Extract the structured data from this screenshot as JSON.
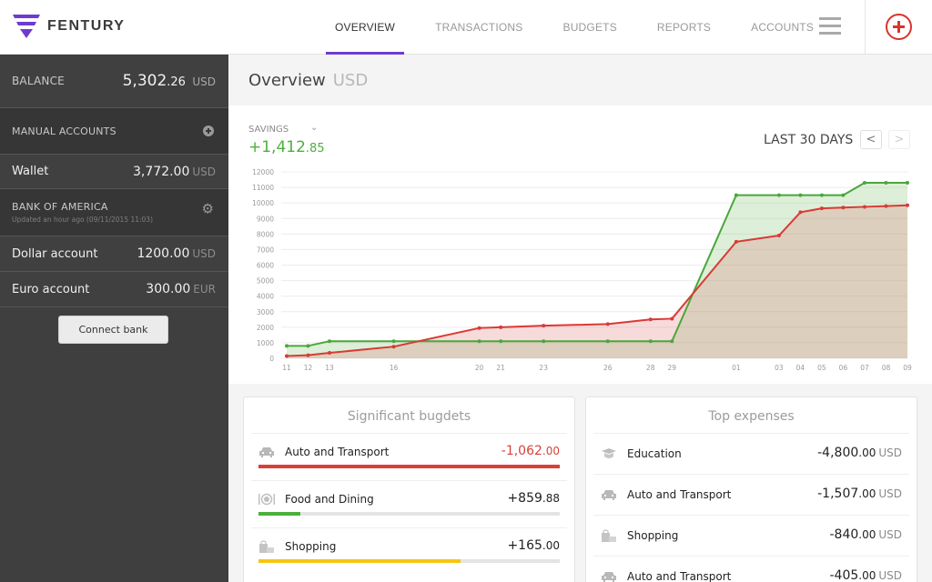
{
  "app": {
    "brand": "FENTURY",
    "brand_color": "#6f3bcf",
    "accent_red": "#d9342b"
  },
  "nav": {
    "items": [
      {
        "label": "OVERVIEW",
        "active": true
      },
      {
        "label": "TRANSACTIONS",
        "active": false
      },
      {
        "label": "BUDGETS",
        "active": false
      },
      {
        "label": "REPORTS",
        "active": false
      },
      {
        "label": "ACCOUNTS",
        "active": false
      }
    ],
    "menu_icon": "hamburger-icon",
    "add_icon": "plus-circle-icon"
  },
  "sidebar": {
    "balance": {
      "label": "BALANCE",
      "int": "5,302",
      "dec": ".26",
      "currency": "USD"
    },
    "manual_accounts": {
      "label": "MANUAL ACCOUNTS",
      "icon": "plus-circle-icon",
      "accounts": [
        {
          "name": "Wallet",
          "amount": "3,772.00",
          "currency": "USD"
        }
      ]
    },
    "bank": {
      "label": "BANK OF AMERICA",
      "updated": "Updated an hour ago (09/11/2015 11:03)",
      "icon": "gear-icon",
      "accounts": [
        {
          "name": "Dollar account",
          "amount": "1200.00",
          "currency": "USD"
        },
        {
          "name": "Euro account",
          "amount": "300.00",
          "currency": "EUR"
        }
      ]
    },
    "connect_button": "Connect bank"
  },
  "main": {
    "title": "Overview",
    "currency": "USD",
    "savings": {
      "label": "SAVINGS",
      "int": "+1,412",
      "dec": ".85"
    },
    "period": {
      "label": "LAST 30 DAYS",
      "prev": "<",
      "next": ">"
    }
  },
  "chart_data": {
    "type": "area",
    "title": "",
    "xlabel": "",
    "ylabel": "",
    "ylim": [
      0,
      12000
    ],
    "yticks": [
      0,
      1000,
      2000,
      3000,
      4000,
      5000,
      6000,
      7000,
      8000,
      9000,
      10000,
      11000,
      12000
    ],
    "grid": true,
    "x_day_index": [
      0,
      1,
      2,
      5,
      9,
      10,
      12,
      15,
      17,
      18,
      21,
      23,
      24,
      25,
      26,
      27,
      28,
      29
    ],
    "x_labels": [
      "11",
      "12",
      "13",
      "16",
      "20",
      "21",
      "23",
      "26",
      "28",
      "29",
      "01",
      "03",
      "04",
      "05",
      "06",
      "07",
      "08",
      "09"
    ],
    "x_range": [
      0,
      29
    ],
    "series": [
      {
        "name": "income",
        "color": "#4aa73c",
        "fill": "rgba(120,190,100,0.25)",
        "values": [
          800,
          800,
          1100,
          1100,
          1100,
          1100,
          1100,
          1100,
          1100,
          1100,
          10500,
          10500,
          10500,
          10500,
          10500,
          11300,
          11300,
          11300
        ]
      },
      {
        "name": "expenses",
        "color": "#d93a35",
        "fill": "rgba(225,110,110,0.25)",
        "values": [
          150,
          200,
          350,
          750,
          1950,
          2000,
          2100,
          2200,
          2500,
          2550,
          7500,
          7900,
          9400,
          9650,
          9700,
          9750,
          9800,
          9850
        ]
      }
    ]
  },
  "budgets": {
    "title": "Significant bugdets",
    "items": [
      {
        "name": "Auto and Transport",
        "icon": "car-icon",
        "int": "-1,062",
        "dec": ".00",
        "negative": true,
        "progress": 1.0,
        "color": "#d8413a"
      },
      {
        "name": "Food and Dining",
        "icon": "dining-icon",
        "int": "+859",
        "dec": ".88",
        "negative": false,
        "progress": 0.14,
        "color": "#4caf3c"
      },
      {
        "name": "Shopping",
        "icon": "shopping-bag-icon",
        "int": "+165",
        "dec": ".00",
        "negative": false,
        "progress": 0.67,
        "color": "#f6c512"
      }
    ]
  },
  "expenses": {
    "title": "Top expenses",
    "items": [
      {
        "name": "Education",
        "icon": "graduation-cap-icon",
        "int": "-4,800",
        "dec": ".00",
        "currency": "USD"
      },
      {
        "name": "Auto and Transport",
        "icon": "car-icon",
        "int": "-1,507",
        "dec": ".00",
        "currency": "USD"
      },
      {
        "name": "Shopping",
        "icon": "shopping-bag-icon",
        "int": "-840",
        "dec": ".00",
        "currency": "USD"
      },
      {
        "name": "Auto and Transport",
        "icon": "car-icon",
        "int": "-405",
        "dec": ".00",
        "currency": "USD"
      }
    ]
  }
}
